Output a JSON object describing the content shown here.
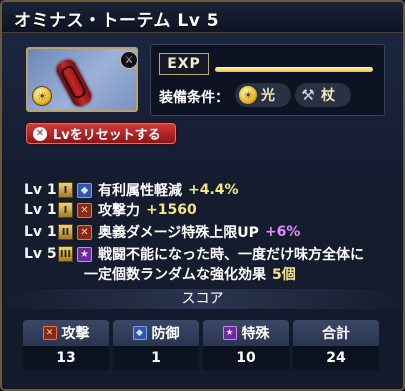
{
  "header": {
    "title": "オミナス・トーテム Lv 5"
  },
  "item": {
    "icon": "red-totem-icon",
    "element_badge": "light-element-icon",
    "weapon_badge": "sword-icon"
  },
  "exp": {
    "label": "EXP",
    "progress_percent": 100
  },
  "equip": {
    "label": "装備条件：",
    "conditions": [
      {
        "icon": "sun-icon",
        "text": "光"
      },
      {
        "icon": "staff-icon",
        "text": "杖"
      }
    ]
  },
  "reset_button": {
    "label": "Lvをリセットする"
  },
  "skills": [
    {
      "lv": "Lv 1",
      "rank": "I",
      "type": "defense",
      "text": "有利属性軽減",
      "value": "+4.4%"
    },
    {
      "lv": "Lv 1",
      "rank": "I",
      "type": "attack",
      "text": "攻撃力",
      "value": "+1560"
    },
    {
      "lv": "Lv 1",
      "rank": "II",
      "type": "attack",
      "text": "奥義ダメージ特殊上限UP",
      "value": "+6%"
    },
    {
      "lv": "Lv 5",
      "rank": "III",
      "type": "special",
      "text": "戦闘不能になった時、一度だけ味方全体に",
      "text2": "一定個数ランダムな強化効果",
      "value": "5個"
    }
  ],
  "score": {
    "title": "スコア",
    "columns": [
      {
        "label": "攻撃",
        "value": "13",
        "icon": "attack-icon"
      },
      {
        "label": "防御",
        "value": "1",
        "icon": "defense-icon"
      },
      {
        "label": "特殊",
        "value": "10",
        "icon": "special-icon"
      },
      {
        "label": "合計",
        "value": "24",
        "icon": ""
      }
    ]
  },
  "colors": {
    "gold": "#f4e58b",
    "purple": "#e08cff",
    "reset_red": "#c42a2a",
    "panel_border": "#6b5a34"
  }
}
